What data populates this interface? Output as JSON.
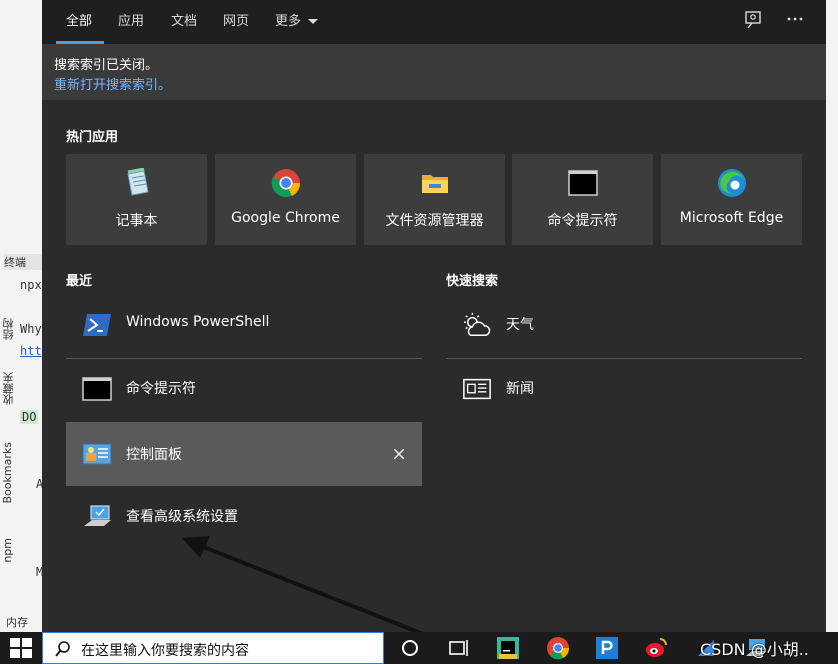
{
  "background_ide": {
    "tab_label": "终端",
    "lines": [
      "npx",
      "Why",
      "htt",
      "DO",
      "A",
      "M"
    ],
    "side_labels": [
      "结构",
      "收藏夹",
      "Bookmarks",
      "npm"
    ],
    "bottom_tab": "内存"
  },
  "search_panel": {
    "tabs": [
      {
        "label": "全部",
        "active": true
      },
      {
        "label": "应用"
      },
      {
        "label": "文档"
      },
      {
        "label": "网页"
      },
      {
        "label": "更多"
      }
    ],
    "notice": {
      "line1": "搜索索引已关闭。",
      "line2": "重新打开搜索索引。"
    },
    "top_apps_title": "热门应用",
    "top_apps": [
      {
        "label": "记事本",
        "icon": "notepad-icon"
      },
      {
        "label": "Google Chrome",
        "icon": "chrome-icon"
      },
      {
        "label": "文件资源管理器",
        "icon": "folder-icon"
      },
      {
        "label": "命令提示符",
        "icon": "cmd-icon"
      },
      {
        "label": "Microsoft Edge",
        "icon": "edge-icon"
      }
    ],
    "recent_title": "最近",
    "recent": [
      {
        "label": "Windows PowerShell",
        "icon": "powershell-icon"
      },
      {
        "label": "命令提示符",
        "icon": "cmd-icon"
      },
      {
        "label": "控制面板",
        "icon": "control-panel-icon",
        "hovered": true
      },
      {
        "label": "查看高级系统设置",
        "icon": "system-settings-icon"
      }
    ],
    "quick_search_title": "快速搜索",
    "quick_search": [
      {
        "label": "天气",
        "icon": "weather-icon"
      },
      {
        "label": "新闻",
        "icon": "news-icon"
      }
    ]
  },
  "taskbar": {
    "search_placeholder": "在这里输入你要搜索的内容",
    "watermark": "CSDN @小胡.."
  },
  "colors": {
    "panel_bg": "#2b2b2b",
    "tab_bar_bg": "#1f1f1f",
    "tile_bg": "#3d3d3d",
    "accent": "#4aa0e6",
    "link": "#78b4ff"
  }
}
